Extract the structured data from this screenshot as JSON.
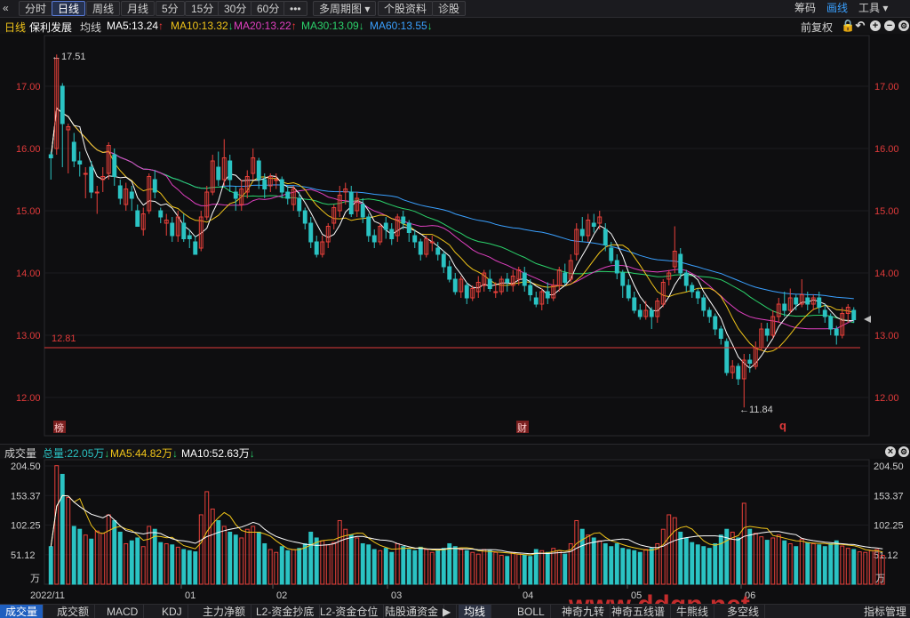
{
  "toolbar": {
    "left": [
      {
        "label": "分时",
        "active": false
      },
      {
        "label": "日线",
        "active": true
      },
      {
        "label": "周线",
        "active": false
      },
      {
        "label": "月线",
        "active": false
      },
      {
        "label": "5分",
        "active": false
      },
      {
        "label": "15分",
        "active": false
      },
      {
        "label": "30分",
        "active": false
      },
      {
        "label": "60分",
        "active": false
      },
      {
        "label": "•••",
        "active": false
      },
      {
        "label": "多周期图 ▾",
        "active": false
      },
      {
        "label": "个股资料",
        "active": false
      },
      {
        "label": "诊股",
        "active": false
      }
    ],
    "back_icon": "«",
    "right": [
      {
        "label": "筹码",
        "active": false
      },
      {
        "label": "画线",
        "active": true
      },
      {
        "label": "工具 ▾",
        "active": false
      }
    ]
  },
  "info": {
    "period": "日线",
    "stock": "保利发展",
    "avg_label": "均线",
    "ma": [
      {
        "text": "MA5:13.24",
        "arrow": "↑",
        "color": "#ffffff"
      },
      {
        "text": "MA10:13.32",
        "arrow": "↓",
        "color": "#f0c419"
      },
      {
        "text": "MA20:13.22",
        "arrow": "↑",
        "color": "#e040c0"
      },
      {
        "text": "MA30:13.09",
        "arrow": "↓",
        "color": "#2bd26b"
      },
      {
        "text": "MA60:13.55",
        "arrow": "↓",
        "color": "#3aa0ff"
      }
    ],
    "adjust": "前复权"
  },
  "price_axis": {
    "ticks": [
      "17.00",
      "16.00",
      "15.00",
      "14.00",
      "13.00",
      "12.00"
    ]
  },
  "annotations": {
    "high": "←17.51",
    "low": "←11.84",
    "ref_line": "12.81",
    "marker_bang": "榜",
    "marker_cai": "财",
    "marker_q": "q"
  },
  "volume": {
    "label": "成交量",
    "total": "总量:22.05万",
    "total_arrow": "↓",
    "ma5": "MA5:44.82万",
    "ma5_arrow": "↓",
    "ma10": "MA10:52.63万",
    "ma10_arrow": "↓",
    "ticks": [
      "204.50",
      "153.37",
      "102.25",
      "51.12"
    ],
    "unit": "万"
  },
  "date_axis": {
    "labels": [
      "2022/11",
      "01",
      "02",
      "03",
      "04",
      "05",
      "06"
    ]
  },
  "tabs_left": [
    "成交量",
    "成交额",
    "MACD",
    "KDJ",
    "主力净额",
    "L2-资金抄底",
    "L2-资金仓位",
    "陆股通资金",
    "▶"
  ],
  "tabs_right": [
    "均线",
    "BOLL",
    "神奇九转",
    "神奇五线谱",
    "牛熊线",
    "多空线",
    "指标管理"
  ],
  "watermark": "www.ddgp.net",
  "chart_data": {
    "type": "candlestick",
    "y_range": [
      11.6,
      17.8
    ],
    "volume_range": [
      0,
      230
    ],
    "candles": [
      [
        15.9,
        15.85,
        15.95,
        15.5
      ],
      [
        16.0,
        17.45,
        17.51,
        15.9
      ],
      [
        17.0,
        16.4,
        17.05,
        15.7
      ],
      [
        16.3,
        16.35,
        16.4,
        15.6
      ],
      [
        16.1,
        15.8,
        16.25,
        15.7
      ],
      [
        15.8,
        15.75,
        15.95,
        15.55
      ],
      [
        15.6,
        15.6,
        15.7,
        15.2
      ],
      [
        15.7,
        15.3,
        15.8,
        15.2
      ],
      [
        15.3,
        15.3,
        15.4,
        14.95
      ],
      [
        15.5,
        15.55,
        15.7,
        15.3
      ],
      [
        15.6,
        16.05,
        16.1,
        15.5
      ],
      [
        15.9,
        15.55,
        16.0,
        15.4
      ],
      [
        15.4,
        15.2,
        15.5,
        15.1
      ],
      [
        15.1,
        15.35,
        15.45,
        15.0
      ],
      [
        15.3,
        15.2,
        15.4,
        15.0
      ],
      [
        15.0,
        14.75,
        15.1,
        14.8
      ],
      [
        14.7,
        14.95,
        15.05,
        14.6
      ],
      [
        15.0,
        15.55,
        15.6,
        14.95
      ],
      [
        15.5,
        15.3,
        15.65,
        15.2
      ],
      [
        15.0,
        14.9,
        15.05,
        14.8
      ],
      [
        14.8,
        14.85,
        14.95,
        14.6
      ],
      [
        14.8,
        14.6,
        14.9,
        14.5
      ],
      [
        14.6,
        14.9,
        15.0,
        14.5
      ],
      [
        14.8,
        14.55,
        14.95,
        14.5
      ],
      [
        14.6,
        14.55,
        14.7,
        14.4
      ],
      [
        14.5,
        14.3,
        14.6,
        14.3
      ],
      [
        14.4,
        14.9,
        15.0,
        14.35
      ],
      [
        14.9,
        15.3,
        15.4,
        14.85
      ],
      [
        15.3,
        15.8,
        15.9,
        15.25
      ],
      [
        15.7,
        15.5,
        15.95,
        15.4
      ],
      [
        15.5,
        15.85,
        16.15,
        15.4
      ],
      [
        15.8,
        15.5,
        15.9,
        15.3
      ],
      [
        15.3,
        15.2,
        15.4,
        15.0
      ],
      [
        15.1,
        15.35,
        15.5,
        15.0
      ],
      [
        15.3,
        15.55,
        15.65,
        15.2
      ],
      [
        15.6,
        15.85,
        16.0,
        15.5
      ],
      [
        15.8,
        15.5,
        15.85,
        15.35
      ],
      [
        15.5,
        15.35,
        15.6,
        15.2
      ],
      [
        15.4,
        15.55,
        15.6,
        15.3
      ],
      [
        15.5,
        15.5,
        15.6,
        15.35
      ],
      [
        15.5,
        15.3,
        15.55,
        15.2
      ],
      [
        15.3,
        15.2,
        15.4,
        15.1
      ],
      [
        15.1,
        15.35,
        15.4,
        15.0
      ],
      [
        15.2,
        15.0,
        15.3,
        14.9
      ],
      [
        15.0,
        14.8,
        15.05,
        14.7
      ],
      [
        14.8,
        14.5,
        14.9,
        14.4
      ],
      [
        14.5,
        14.3,
        14.6,
        14.25
      ],
      [
        14.3,
        14.5,
        14.6,
        14.25
      ],
      [
        14.5,
        14.75,
        14.8,
        14.4
      ],
      [
        14.8,
        15.05,
        15.1,
        14.7
      ],
      [
        15.0,
        15.25,
        15.4,
        14.9
      ],
      [
        15.3,
        15.35,
        15.45,
        15.1
      ],
      [
        15.3,
        14.95,
        15.4,
        14.9
      ],
      [
        15.0,
        15.2,
        15.3,
        14.9
      ],
      [
        15.1,
        14.9,
        15.2,
        14.8
      ],
      [
        14.9,
        14.6,
        14.95,
        14.5
      ],
      [
        14.6,
        14.5,
        14.7,
        14.4
      ],
      [
        14.5,
        14.75,
        14.8,
        14.45
      ],
      [
        14.8,
        14.7,
        14.9,
        14.55
      ],
      [
        14.7,
        14.55,
        14.8,
        14.45
      ],
      [
        14.6,
        14.9,
        14.95,
        14.5
      ],
      [
        14.9,
        14.8,
        15.0,
        14.7
      ],
      [
        14.8,
        14.65,
        14.85,
        14.5
      ],
      [
        14.6,
        14.5,
        14.7,
        14.4
      ],
      [
        14.5,
        14.3,
        14.55,
        14.2
      ],
      [
        14.3,
        14.55,
        14.6,
        14.25
      ],
      [
        14.5,
        14.5,
        14.6,
        14.35
      ],
      [
        14.4,
        14.3,
        14.5,
        14.2
      ],
      [
        14.3,
        14.1,
        14.35,
        14.0
      ],
      [
        14.1,
        13.9,
        14.2,
        13.85
      ],
      [
        13.9,
        13.7,
        14.0,
        13.65
      ],
      [
        13.7,
        13.9,
        13.95,
        13.6
      ],
      [
        13.8,
        13.6,
        13.85,
        13.5
      ],
      [
        13.6,
        13.75,
        13.8,
        13.55
      ],
      [
        13.7,
        13.85,
        13.95,
        13.6
      ],
      [
        13.8,
        14.0,
        14.05,
        13.7
      ],
      [
        13.9,
        13.75,
        14.05,
        13.7
      ],
      [
        13.7,
        13.7,
        13.85,
        13.6
      ],
      [
        13.7,
        13.9,
        13.95,
        13.65
      ],
      [
        13.9,
        13.85,
        14.0,
        13.7
      ],
      [
        13.8,
        13.95,
        14.05,
        13.7
      ],
      [
        13.9,
        14.05,
        14.1,
        13.8
      ],
      [
        14.0,
        13.8,
        14.1,
        13.7
      ],
      [
        13.8,
        13.65,
        13.9,
        13.55
      ],
      [
        13.6,
        13.5,
        13.7,
        13.45
      ],
      [
        13.5,
        13.7,
        13.75,
        13.4
      ],
      [
        13.7,
        13.6,
        13.85,
        13.5
      ],
      [
        13.6,
        13.8,
        13.9,
        13.55
      ],
      [
        13.8,
        14.05,
        14.1,
        13.7
      ],
      [
        14.0,
        13.85,
        14.15,
        13.8
      ],
      [
        13.9,
        14.2,
        14.3,
        13.85
      ],
      [
        14.3,
        14.7,
        14.8,
        14.2
      ],
      [
        14.7,
        14.6,
        14.9,
        14.5
      ],
      [
        14.6,
        14.85,
        14.95,
        14.5
      ],
      [
        14.8,
        14.75,
        14.95,
        14.65
      ],
      [
        14.8,
        14.9,
        15.0,
        14.7
      ],
      [
        14.7,
        14.45,
        14.8,
        14.35
      ],
      [
        14.4,
        14.2,
        14.5,
        14.15
      ],
      [
        14.2,
        14.0,
        14.3,
        13.9
      ],
      [
        14.0,
        13.8,
        14.05,
        13.6
      ],
      [
        13.8,
        13.6,
        13.9,
        13.55
      ],
      [
        13.6,
        13.4,
        13.7,
        13.35
      ],
      [
        13.4,
        13.3,
        13.5,
        13.25
      ],
      [
        13.3,
        13.4,
        13.55,
        13.25
      ],
      [
        13.4,
        13.3,
        13.45,
        13.1
      ],
      [
        13.3,
        13.55,
        13.6,
        13.2
      ],
      [
        13.5,
        13.85,
        13.9,
        13.45
      ],
      [
        13.9,
        14.0,
        14.05,
        13.8
      ],
      [
        14.1,
        14.35,
        14.75,
        14.0
      ],
      [
        14.3,
        14.0,
        14.4,
        13.9
      ],
      [
        14.0,
        13.8,
        14.05,
        13.7
      ],
      [
        13.8,
        13.7,
        13.85,
        13.6
      ],
      [
        13.7,
        13.6,
        13.75,
        13.5
      ],
      [
        13.6,
        13.4,
        13.65,
        13.3
      ],
      [
        13.4,
        13.3,
        13.45,
        13.2
      ],
      [
        13.3,
        13.1,
        13.35,
        13.0
      ],
      [
        13.1,
        12.95,
        13.15,
        12.85
      ],
      [
        12.9,
        12.4,
        12.95,
        12.35
      ],
      [
        12.4,
        12.5,
        12.6,
        12.3
      ],
      [
        12.5,
        12.3,
        12.55,
        12.2
      ],
      [
        12.3,
        12.6,
        12.7,
        11.84
      ],
      [
        12.6,
        12.55,
        12.7,
        12.4
      ],
      [
        12.5,
        12.8,
        12.9,
        12.45
      ],
      [
        12.8,
        13.1,
        13.2,
        12.75
      ],
      [
        13.1,
        13.0,
        13.2,
        12.9
      ],
      [
        13.0,
        13.3,
        13.4,
        12.95
      ],
      [
        13.3,
        13.5,
        13.6,
        13.2
      ],
      [
        13.5,
        13.4,
        13.7,
        13.3
      ],
      [
        13.4,
        13.6,
        13.75,
        13.35
      ],
      [
        13.6,
        13.5,
        13.65,
        13.4
      ],
      [
        13.5,
        13.65,
        13.9,
        13.45
      ],
      [
        13.6,
        13.5,
        13.7,
        13.4
      ],
      [
        13.5,
        13.6,
        13.65,
        13.4
      ],
      [
        13.6,
        13.45,
        13.7,
        13.35
      ],
      [
        13.4,
        13.3,
        13.5,
        13.2
      ],
      [
        13.3,
        13.1,
        13.35,
        13.0
      ],
      [
        13.1,
        13.0,
        13.15,
        12.85
      ],
      [
        13.0,
        13.35,
        13.45,
        12.95
      ],
      [
        13.35,
        13.45,
        13.5,
        13.2
      ],
      [
        13.4,
        13.25,
        13.45,
        13.2
      ]
    ],
    "volumes": [
      65,
      205,
      190,
      150,
      100,
      95,
      85,
      78,
      92,
      88,
      120,
      110,
      90,
      70,
      75,
      80,
      65,
      100,
      95,
      72,
      70,
      68,
      64,
      60,
      58,
      56,
      120,
      160,
      130,
      110,
      100,
      90,
      85,
      80,
      95,
      100,
      90,
      70,
      60,
      55,
      65,
      58,
      60,
      62,
      70,
      90,
      80,
      75,
      68,
      72,
      110,
      95,
      85,
      80,
      70,
      68,
      60,
      58,
      62,
      55,
      70,
      65,
      60,
      58,
      64,
      60,
      55,
      58,
      62,
      70,
      65,
      60,
      58,
      55,
      52,
      60,
      58,
      55,
      50,
      48,
      55,
      52,
      50,
      48,
      60,
      58,
      55,
      62,
      58,
      52,
      70,
      110,
      95,
      85,
      80,
      75,
      70,
      65,
      70,
      62,
      60,
      58,
      55,
      60,
      62,
      70,
      95,
      120,
      115,
      90,
      80,
      72,
      68,
      65,
      62,
      70,
      85,
      95,
      90,
      80,
      140,
      95,
      88,
      82,
      76,
      80,
      85,
      75,
      70,
      65,
      78,
      72,
      70,
      68,
      65,
      70,
      75,
      66,
      62,
      60,
      56,
      55,
      58,
      60,
      50
    ]
  }
}
